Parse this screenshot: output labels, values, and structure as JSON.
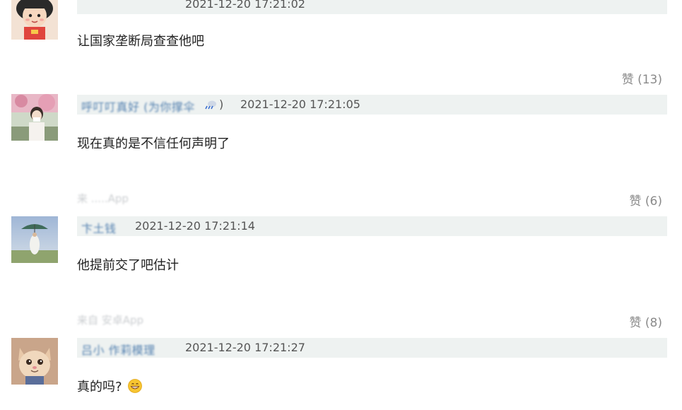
{
  "comments": [
    {
      "username": "",
      "timestamp": "2021-12-20 17:21:02",
      "text": "让国家垄断局查查他吧",
      "likes": "赞 (13)",
      "source": ""
    },
    {
      "username": "呼叮叮真好 (为你撑伞",
      "username_suffix": ")",
      "timestamp": "2021-12-20 17:21:05",
      "text": "现在真的是不信任何声明了",
      "likes": "赞 (6)",
      "source": "来 .....App"
    },
    {
      "username": "卞土钱",
      "timestamp": "2021-12-20 17:21:14",
      "text": "他提前交了吧估计",
      "likes": "赞 (8)",
      "source": "来自 安卓App"
    },
    {
      "username": "吕小 作莉模理",
      "timestamp": "2021-12-20 17:21:27",
      "text": "真的吗?",
      "emoji": "grinning-emoji"
    }
  ],
  "colors": {
    "meta_bar_bg": "#eef2f1",
    "username": "#3a6ea5",
    "timestamp": "#555555",
    "likes": "#8a8a8a"
  }
}
